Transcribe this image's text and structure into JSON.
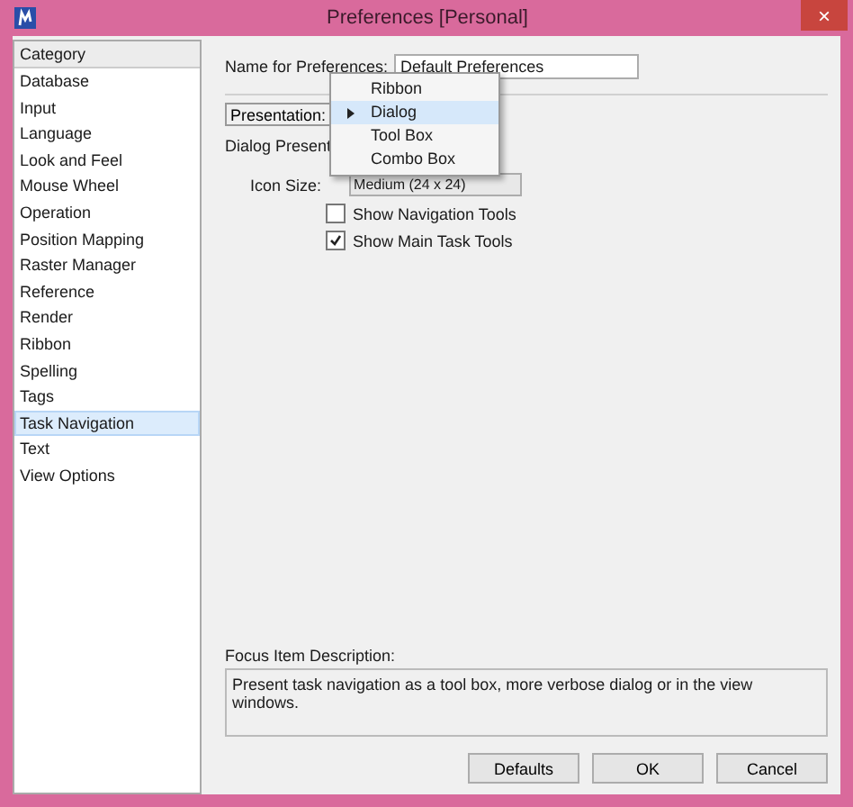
{
  "window": {
    "title": "Preferences [Personal]",
    "close": "×"
  },
  "sidebar": {
    "header": "Category",
    "items": [
      {
        "label": "Database",
        "selected": false
      },
      {
        "label": "Input",
        "selected": false
      },
      {
        "label": "Language",
        "selected": false
      },
      {
        "label": "Look and Feel",
        "selected": false
      },
      {
        "label": "Mouse Wheel",
        "selected": false
      },
      {
        "label": "Operation",
        "selected": false
      },
      {
        "label": "Position Mapping",
        "selected": false
      },
      {
        "label": "Raster Manager",
        "selected": false
      },
      {
        "label": "Reference",
        "selected": false
      },
      {
        "label": "Render",
        "selected": false
      },
      {
        "label": "Ribbon",
        "selected": false
      },
      {
        "label": "Spelling",
        "selected": false
      },
      {
        "label": "Tags",
        "selected": false
      },
      {
        "label": "Task Navigation",
        "selected": true
      },
      {
        "label": "Text",
        "selected": false
      },
      {
        "label": "View Options",
        "selected": false
      }
    ]
  },
  "name_field": {
    "label": "Name for Preferences:",
    "value": "Default Preferences"
  },
  "presentation": {
    "label": "Presentation:",
    "menu": [
      {
        "label": "Ribbon",
        "selected": false
      },
      {
        "label": "Dialog",
        "selected": true
      },
      {
        "label": "Tool Box",
        "selected": false
      },
      {
        "label": "Combo Box",
        "selected": false
      }
    ]
  },
  "dialog_group": {
    "label": "Dialog Present",
    "icon_size": {
      "label": "Icon Size:",
      "value": "Medium (24 x 24)"
    },
    "checkboxes": [
      {
        "label": "Show Navigation Tools",
        "checked": false
      },
      {
        "label": "Show Main Task Tools",
        "checked": true
      }
    ]
  },
  "description": {
    "label": "Focus Item Description:",
    "text": "Present task navigation as a tool box, more verbose dialog or in the view windows."
  },
  "buttons": [
    "Defaults",
    "OK",
    "Cancel"
  ]
}
